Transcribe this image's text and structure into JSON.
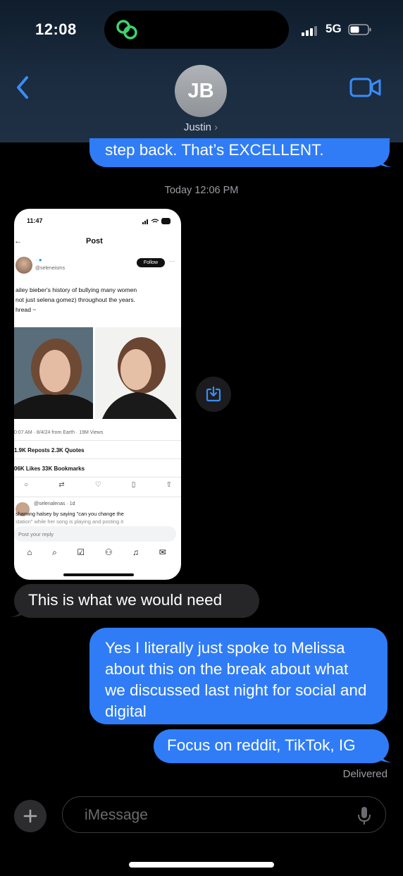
{
  "status_bar": {
    "time": "12:08",
    "network": "5G"
  },
  "header": {
    "avatar_initials": "JB",
    "contact_name": "Justin",
    "chevron": "›"
  },
  "messages": {
    "partial_sent": "step back.  That’s EXCELLENT.",
    "timestamp": "Today 12:06 PM",
    "received_1": "This is what we would need",
    "sent_1": "Yes I literally just spoke to Melissa about this on the break about what we discussed last night for social and digital",
    "sent_2": "Focus on reddit, TikTok, IG",
    "status": "Delivered"
  },
  "attachment": {
    "time": "11:47",
    "title": "Post",
    "follow": "Follow",
    "handle": "@seleneisms",
    "body_lines": [
      "ailey bieber's history of bullying many women",
      "not just selena gomez) throughout the years.",
      "hread ~"
    ],
    "meta": "0:07 AM · 8/4/24 from Earth · 19M Views",
    "reposts_quotes": "1.9K Reposts  2.3K Quotes",
    "likes_bookmarks": "06K Likes  33K Bookmarks",
    "reply_handle": "@selenalenas · 1d",
    "reply_text_1": "shaming halsey by saying \"can you change the",
    "reply_text_2": "station\" while her song is playing and posting it",
    "reply_placeholder": "Post your reply"
  },
  "composer": {
    "placeholder": "iMessage"
  },
  "colors": {
    "sent": "#2f7cf6",
    "received": "#262628",
    "background": "#000000"
  },
  "icons": [
    "back-chevron-icon",
    "video-camera-icon",
    "save-download-icon",
    "plus-icon",
    "microphone-icon"
  ]
}
